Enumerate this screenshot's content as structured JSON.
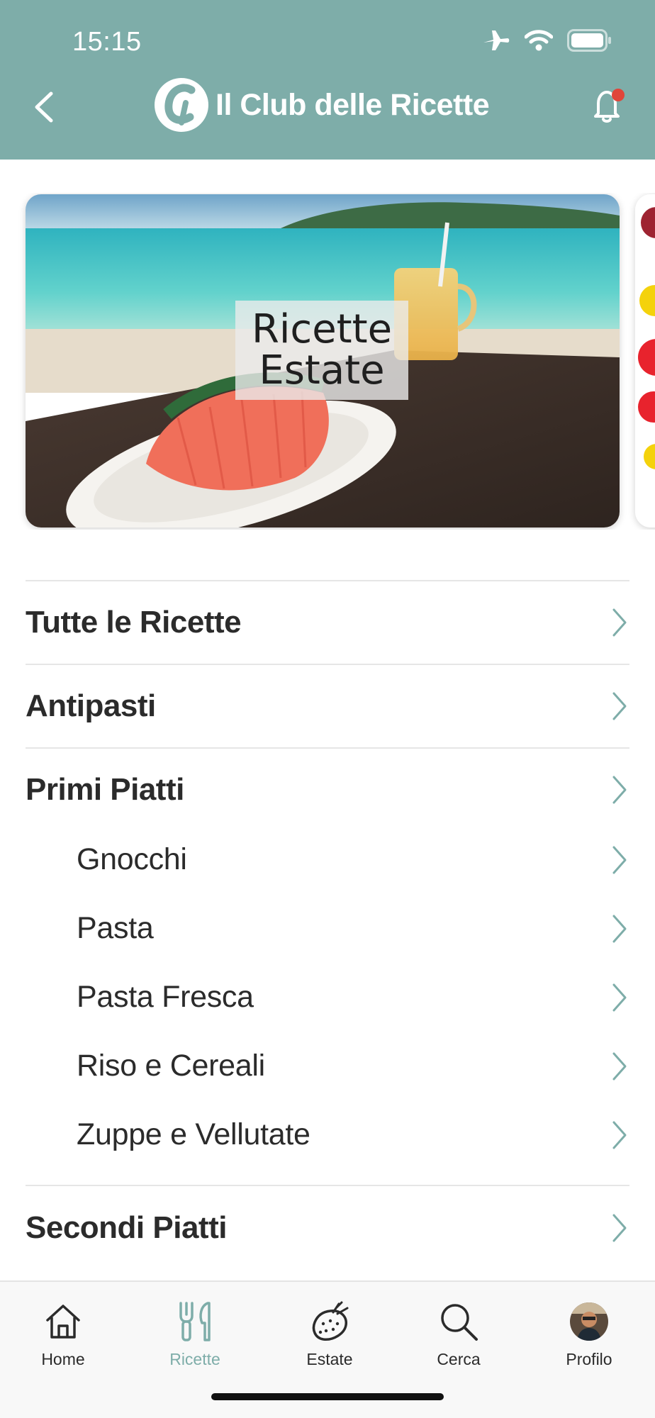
{
  "status_bar": {
    "time": "15:15",
    "icons": [
      "airplane-icon",
      "wifi-icon",
      "battery-icon"
    ]
  },
  "header": {
    "app_title": "Il Club delle Ricette",
    "logo_letter": "C",
    "back_icon": "chevron-left-icon",
    "notification_icon": "bell-icon",
    "has_notification_dot": true
  },
  "carousel": {
    "cards": [
      {
        "label": "Ricette Estate"
      }
    ]
  },
  "categories": [
    {
      "label": "Tutte le Ricette"
    },
    {
      "label": "Antipasti"
    },
    {
      "label": "Primi Piatti",
      "subcategories": [
        "Gnocchi",
        "Pasta",
        "Pasta Fresca",
        "Riso e Cereali",
        "Zuppe e Vellutate"
      ]
    },
    {
      "label": "Secondi Piatti"
    }
  ],
  "tabbar": {
    "tabs": [
      {
        "label": "Home",
        "icon": "house-icon"
      },
      {
        "label": "Ricette",
        "icon": "fork-knife-icon",
        "active": true
      },
      {
        "label": "Estate",
        "icon": "strawberry-icon"
      },
      {
        "label": "Cerca",
        "icon": "search-icon"
      },
      {
        "label": "Profilo",
        "icon": "avatar"
      }
    ]
  },
  "colors": {
    "brand": "#7eada9",
    "text": "#2b2b2b",
    "chevron": "#7eada9",
    "notification_dot": "#e0453a"
  }
}
